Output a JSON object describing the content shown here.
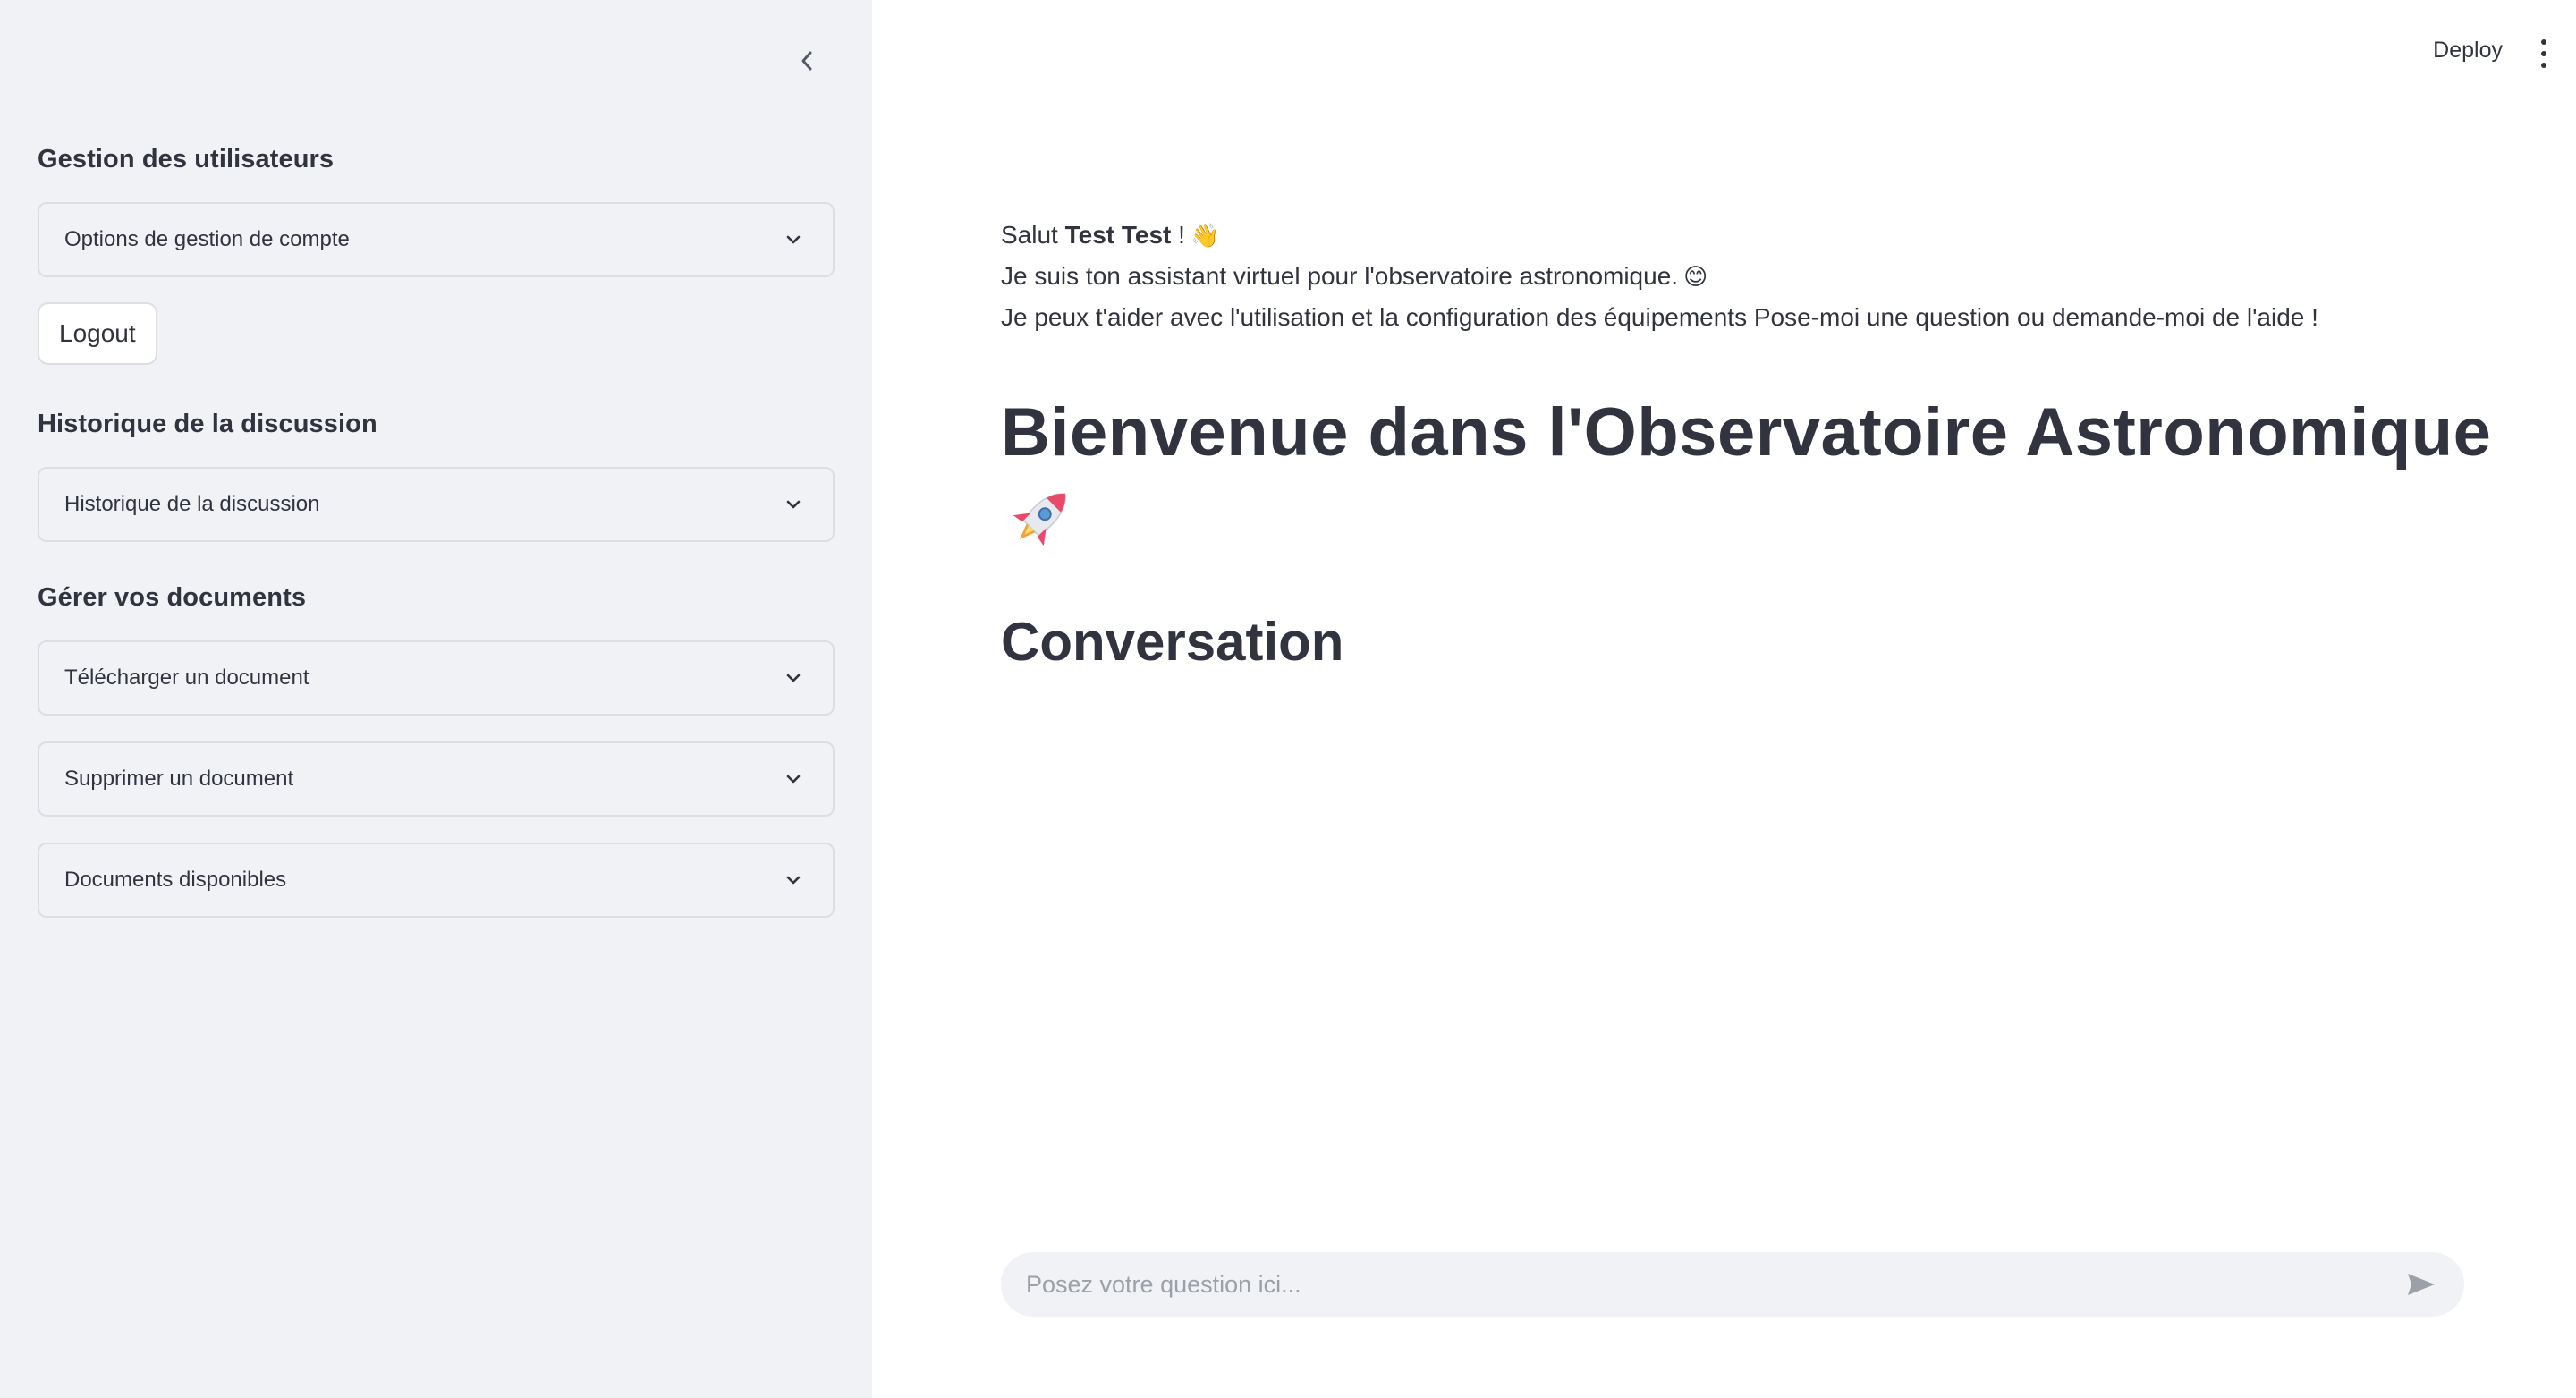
{
  "sidebar": {
    "sections": [
      {
        "heading": "Gestion des utilisateurs"
      },
      {
        "heading": "Historique de la discussion"
      },
      {
        "heading": "Gérer vos documents"
      }
    ],
    "expanders": [
      {
        "label": "Options de gestion de compte"
      },
      {
        "label": "Historique de la discussion"
      },
      {
        "label": "Télécharger un document"
      },
      {
        "label": "Supprimer un document"
      },
      {
        "label": "Documents disponibles"
      }
    ],
    "logout_label": "Logout"
  },
  "header": {
    "deploy_label": "Deploy"
  },
  "main": {
    "greeting": {
      "prefix": "Salut ",
      "name": "Test Test",
      "suffix": " !",
      "wave_emoji": "👋",
      "line2": "Je suis ton assistant virtuel pour l'observatoire astronomique.",
      "smile_emoji": "😊",
      "line3": "Je peux t'aider avec l'utilisation et la configuration des équipements Pose-moi une question ou demande-moi de l'aide !"
    },
    "title": "Bienvenue dans l'Observatoire Astronomique",
    "subtitle": "Conversation"
  },
  "chat": {
    "placeholder": "Posez votre question ici..."
  }
}
